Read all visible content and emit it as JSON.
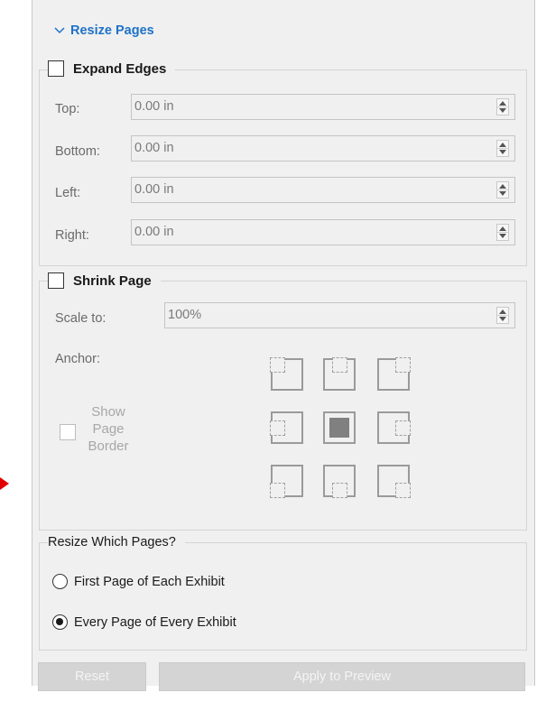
{
  "section_title": "Resize Pages",
  "expand_edges": {
    "label": "Expand Edges",
    "fields": [
      {
        "label": "Top:",
        "value": "0.00 in"
      },
      {
        "label": "Bottom:",
        "value": "0.00 in"
      },
      {
        "label": "Left:",
        "value": "0.00 in"
      },
      {
        "label": "Right:",
        "value": "0.00 in"
      }
    ]
  },
  "shrink_page": {
    "label": "Shrink Page",
    "scale_label": "Scale to:",
    "scale_value": "100%",
    "anchor_label": "Anchor:",
    "anchor_selected": "middle-center",
    "show_border_lines": [
      "Show",
      "Page",
      "Border"
    ]
  },
  "resize_which": {
    "title": "Resize Which Pages?",
    "options": [
      {
        "label": "First Page of Each Exhibit",
        "selected": false
      },
      {
        "label": "Every Page of Every Exhibit",
        "selected": true
      }
    ]
  },
  "buttons": {
    "reset": "Reset",
    "apply": "Apply to Preview"
  },
  "colors": {
    "accent": "#1e72c8",
    "pointer_arrow": "#e00000"
  }
}
